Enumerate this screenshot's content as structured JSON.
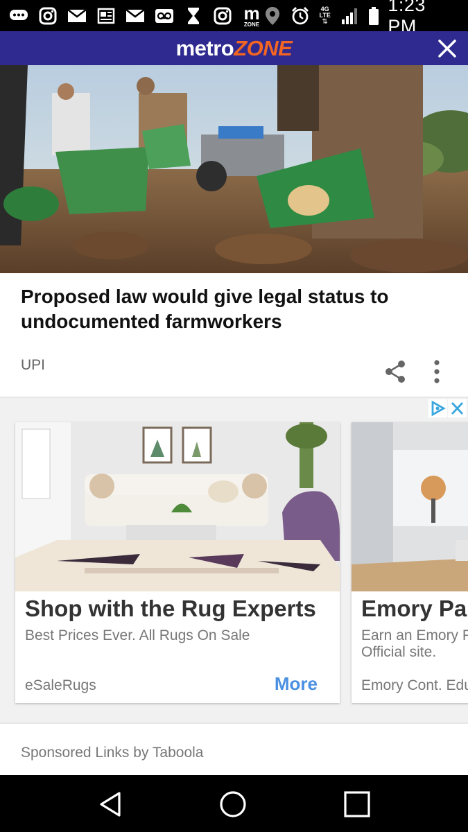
{
  "status_bar": {
    "time": "1:23 PM",
    "network": "4G LTE",
    "icons": [
      "chat-icon",
      "instagram-icon",
      "mail-icon",
      "news-icon",
      "mail-icon",
      "voicemail-icon",
      "hourglass-icon",
      "instagram-icon",
      "metrozone-icon",
      "location-icon",
      "alarm-icon",
      "lte-icon",
      "signal-icon",
      "battery-icon"
    ],
    "metrozone_icon_text": "m",
    "metrozone_icon_sub": "ZONE"
  },
  "header": {
    "brand_part1": "metro",
    "brand_part2": "ZONE",
    "brand_color": "#2e2a8f",
    "accent_color": "#f26522"
  },
  "article": {
    "headline": "Proposed law would give legal status to undocumented farmworkers",
    "source": "UPI"
  },
  "ads": [
    {
      "title": "Shop with the Rug Experts",
      "description": "Best Prices Ever. All Rugs On Sale",
      "advertiser": "eSaleRugs",
      "cta": "More"
    },
    {
      "title": "Emory Para",
      "description": "Earn an Emory Pa Official site.",
      "advertiser": "Emory Cont. Educ"
    }
  ],
  "sponsored_label": "Sponsored Links by Taboola",
  "colors": {
    "link_blue": "#4a90e2"
  }
}
